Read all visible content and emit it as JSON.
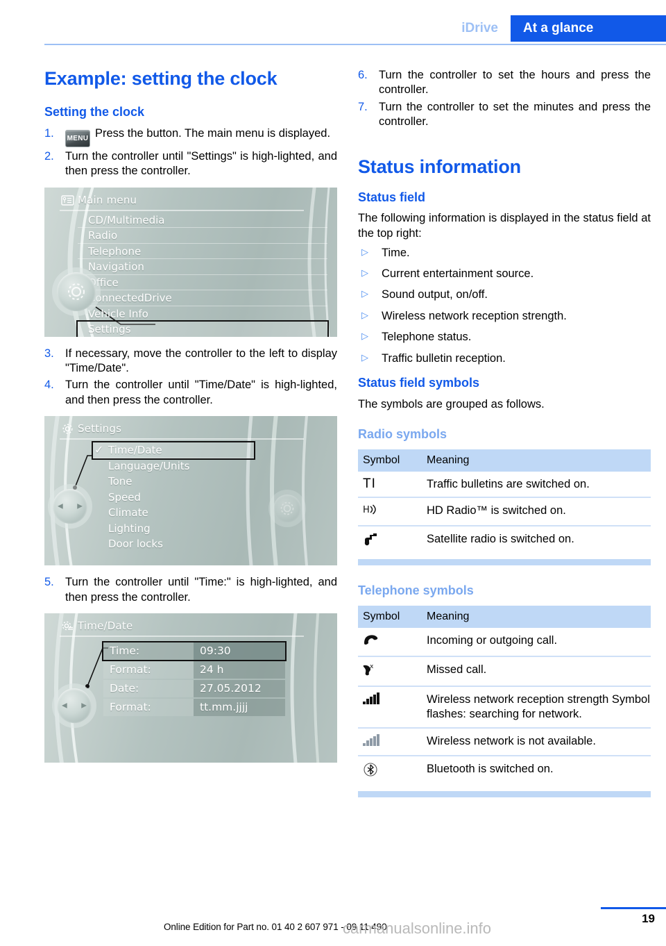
{
  "header": {
    "chapter": "iDrive",
    "section": "At a glance"
  },
  "left": {
    "title": "Example: setting the clock",
    "subheading": "Setting the clock",
    "menu_button_label": "MENU",
    "steps": [
      {
        "num": "1.",
        "text": "Press the button. The main menu is displayed."
      },
      {
        "num": "2.",
        "text": "Turn the controller until \"Settings\" is high-lighted, and then press the controller."
      },
      {
        "num": "3.",
        "text": "If necessary, move the controller to the left to display \"Time/Date\"."
      },
      {
        "num": "4.",
        "text": "Turn the controller until \"Time/Date\" is high-lighted, and then press the controller."
      },
      {
        "num": "5.",
        "text": "Turn the controller until \"Time:\" is high-lighted, and then press the controller."
      }
    ],
    "figure_main_menu": {
      "header_title": "Main menu",
      "header_icon": "list-menu-icon",
      "items": [
        {
          "label": "CD/Multimedia",
          "selected": false
        },
        {
          "label": "Radio",
          "selected": false
        },
        {
          "label": "Telephone",
          "selected": false
        },
        {
          "label": "Navigation",
          "selected": false
        },
        {
          "label": "Office",
          "selected": false
        },
        {
          "label": "ConnectedDrive",
          "selected": false
        },
        {
          "label": "Vehicle Info",
          "selected": false
        },
        {
          "label": "Settings",
          "selected": true
        }
      ]
    },
    "figure_settings": {
      "header_title": "Settings",
      "header_icon": "gear-icon",
      "items": [
        {
          "label": "Time/Date",
          "selected": true,
          "check": "✓"
        },
        {
          "label": "Language/Units",
          "selected": false,
          "check": ""
        },
        {
          "label": "Tone",
          "selected": false,
          "check": ""
        },
        {
          "label": "Speed",
          "selected": false,
          "check": ""
        },
        {
          "label": "Climate",
          "selected": false,
          "check": ""
        },
        {
          "label": "Lighting",
          "selected": false,
          "check": ""
        },
        {
          "label": "Door locks",
          "selected": false,
          "check": ""
        }
      ]
    },
    "figure_time_date": {
      "header_title": "Time/Date",
      "header_icon": "gear-list-icon",
      "rows": [
        {
          "label": "Time:",
          "value": "09:30",
          "selected": true
        },
        {
          "label": "Format:",
          "value": "24 h",
          "selected": false
        },
        {
          "label": "Date:",
          "value": "27.05.2012",
          "selected": false
        },
        {
          "label": "Format:",
          "value": "tt.mm.jjjj",
          "selected": false
        }
      ]
    }
  },
  "right": {
    "steps": [
      {
        "num": "6.",
        "text": "Turn the controller to set the hours and press the controller."
      },
      {
        "num": "7.",
        "text": "Turn the controller to set the minutes and press the controller."
      }
    ],
    "title": "Status information",
    "status_field": {
      "heading": "Status field",
      "intro": "The following information is displayed in the status field at the top right:",
      "items": [
        "Time.",
        "Current entertainment source.",
        "Sound output, on/off.",
        "Wireless network reception strength.",
        "Telephone status.",
        "Traffic bulletin reception."
      ]
    },
    "status_field_symbols": {
      "heading": "Status field symbols",
      "intro": "The symbols are grouped as follows."
    },
    "radio_symbols": {
      "heading": "Radio symbols",
      "columns": [
        "Symbol",
        "Meaning"
      ],
      "rows": [
        {
          "symbol_name": "traffic-bulletin-icon",
          "symbol_text": "TI",
          "meaning": "Traffic bulletins are switched on."
        },
        {
          "symbol_name": "hd-radio-icon",
          "symbol_text": "Hʕ",
          "meaning": "HD Radio™ is switched on."
        },
        {
          "symbol_name": "satellite-radio-icon",
          "symbol_text": "",
          "meaning": "Satellite radio is switched on."
        }
      ]
    },
    "telephone_symbols": {
      "heading": "Telephone symbols",
      "columns": [
        "Symbol",
        "Meaning"
      ],
      "rows": [
        {
          "symbol_name": "phone-handset-icon",
          "symbol_text": "",
          "meaning": "Incoming or outgoing call."
        },
        {
          "symbol_name": "missed-call-icon",
          "symbol_text": "",
          "meaning": "Missed call."
        },
        {
          "symbol_name": "signal-bars-icon",
          "symbol_text": "",
          "meaning": "Wireless network reception strength Symbol flashes: searching for network."
        },
        {
          "symbol_name": "signal-bars-unavailable-icon",
          "symbol_text": "",
          "meaning": "Wireless network is not available."
        },
        {
          "symbol_name": "bluetooth-icon",
          "symbol_text": "",
          "meaning": "Bluetooth is switched on."
        }
      ]
    }
  },
  "footer": {
    "edition": "Online Edition for Part no. 01 40 2 607 971 - 09 11 490",
    "page_number": "19",
    "watermark": "carmanualsonline.info"
  },
  "colors": {
    "accent_blue": "#1159e8",
    "light_blue": "#7aa8ef",
    "table_header": "#bfd8f6",
    "table_rule": "#cfe0f7",
    "header_tab_bg": "#1159e8"
  }
}
